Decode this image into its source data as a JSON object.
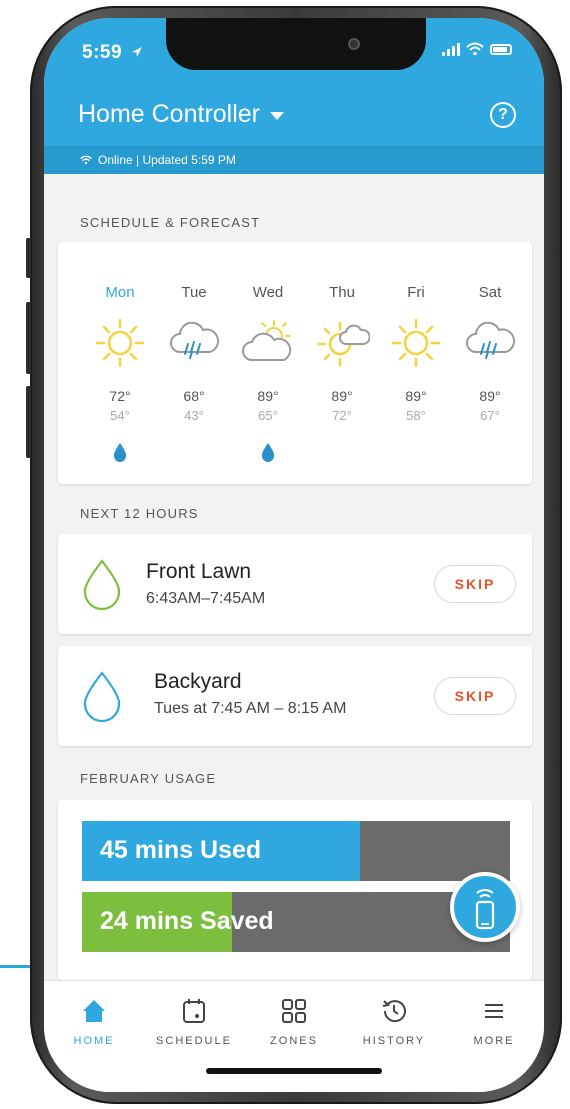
{
  "status": {
    "time": "5:59"
  },
  "header": {
    "title": "Home Controller",
    "online_text": "Online | Updated 5:59 PM"
  },
  "forecast": {
    "label": "SCHEDULE & FORECAST",
    "days": [
      {
        "name": "Mon",
        "hi": "72°",
        "lo": "54°",
        "icon": "sun-icon",
        "rain": true
      },
      {
        "name": "Tue",
        "hi": "68°",
        "lo": "43°",
        "icon": "rain-cloud-icon",
        "rain": false
      },
      {
        "name": "Wed",
        "hi": "89°",
        "lo": "65°",
        "icon": "partly-sunny-icon",
        "rain": true
      },
      {
        "name": "Thu",
        "hi": "89°",
        "lo": "72°",
        "icon": "sun-cloud-icon",
        "rain": false
      },
      {
        "name": "Fri",
        "hi": "89°",
        "lo": "58°",
        "icon": "sun-icon",
        "rain": false
      },
      {
        "name": "Sat",
        "hi": "89°",
        "lo": "67°",
        "icon": "rain-cloud-icon",
        "rain": false
      }
    ]
  },
  "next": {
    "label": "NEXT 12 HOURS",
    "zones": [
      {
        "name": "Front Lawn",
        "time": "6:43AM–7:45AM",
        "skip_label": "SKIP",
        "icon_color": "#7cbf3f"
      },
      {
        "name": "Backyard",
        "time": "Tues at 7:45 AM – 8:15 AM",
        "skip_label": "SKIP",
        "icon_color": "#2ea8de"
      }
    ]
  },
  "usage": {
    "label": "FEBRUARY USAGE",
    "used_text": "45 mins Used",
    "used_fraction": 0.65,
    "saved_text": "24 mins Saved",
    "saved_fraction": 0.35
  },
  "tabs": [
    {
      "label": "HOME",
      "icon": "home-icon",
      "active": true
    },
    {
      "label": "SCHEDULE",
      "icon": "calendar-icon",
      "active": false
    },
    {
      "label": "ZONES",
      "icon": "grid-icon",
      "active": false
    },
    {
      "label": "HISTORY",
      "icon": "history-icon",
      "active": false
    },
    {
      "label": "MORE",
      "icon": "menu-icon",
      "active": false
    }
  ],
  "colors": {
    "accent": "#2ea8de",
    "green": "#7cbf3f",
    "skip": "#e2532b",
    "sun": "#f5d33b"
  }
}
